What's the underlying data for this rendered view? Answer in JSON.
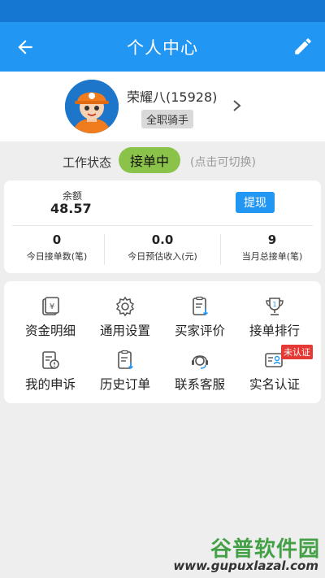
{
  "appbar": {
    "title": "个人中心"
  },
  "profile": {
    "name": "荣耀八(15928)",
    "badge": "全职骑手"
  },
  "work_status": {
    "label": "工作状态",
    "state": "接单中",
    "hint": "(点击可切换)"
  },
  "balance": {
    "label": "余额",
    "value": "48.57",
    "withdraw": "提现"
  },
  "stats": [
    {
      "value": "0",
      "label": "今日接单数(笔)"
    },
    {
      "value": "0.0",
      "label": "今日预估收入(元)"
    },
    {
      "value": "9",
      "label": "当月总接单(笔)"
    }
  ],
  "menu": [
    {
      "label": "资金明细",
      "icon": "wallet-icon"
    },
    {
      "label": "通用设置",
      "icon": "gear-icon"
    },
    {
      "label": "买家评价",
      "icon": "clipboard-icon"
    },
    {
      "label": "接单排行",
      "icon": "trophy-icon"
    },
    {
      "label": "我的申诉",
      "icon": "appeal-icon"
    },
    {
      "label": "历史订单",
      "icon": "order-history-icon"
    },
    {
      "label": "联系客服",
      "icon": "customer-service-icon"
    },
    {
      "label": "实名认证",
      "icon": "id-card-icon",
      "tag": "未认证"
    }
  ],
  "watermark": {
    "title": "谷普软件园",
    "url": "www.gupuxlazal.com"
  },
  "colors": {
    "primary": "#2196f3",
    "status_green": "#8bc34a",
    "tag_red": "#e53935"
  }
}
